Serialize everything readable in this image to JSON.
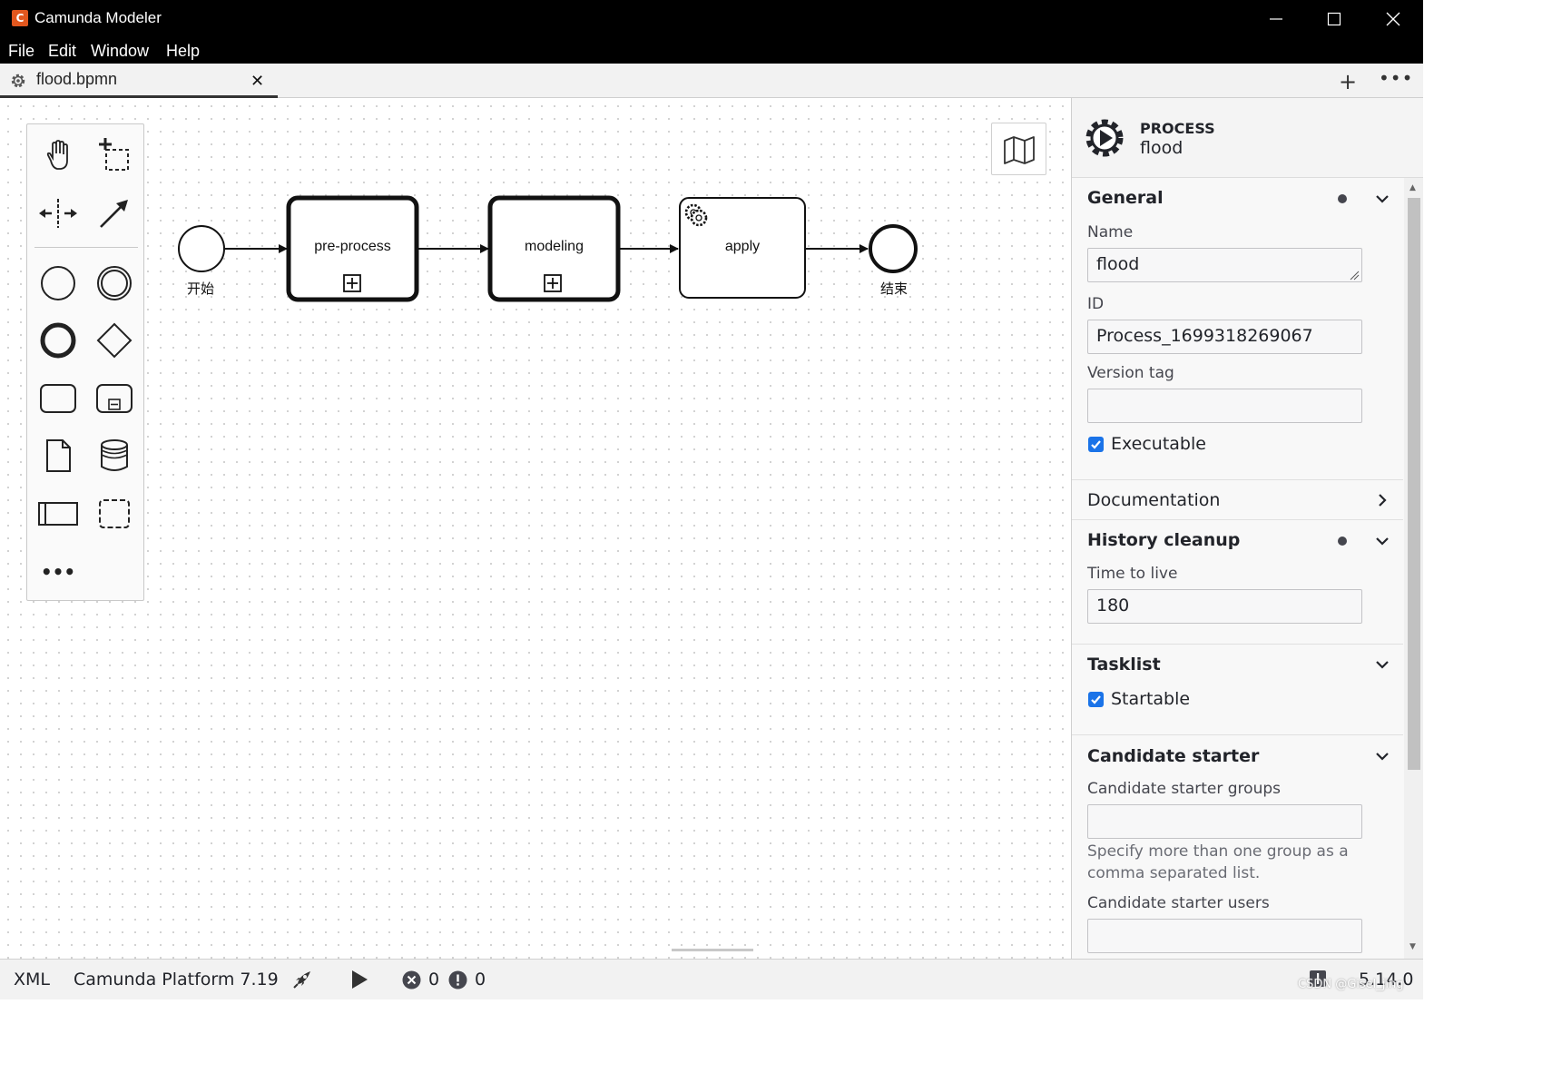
{
  "window": {
    "title": "Camunda Modeler",
    "logo_glyph": "C"
  },
  "menu": {
    "items": [
      "File",
      "Edit",
      "Window",
      "Help"
    ]
  },
  "tabs": {
    "active": {
      "label": "flood.bpmn",
      "close_glyph": "✕"
    },
    "add_glyph": "+",
    "more_glyph": "•••"
  },
  "palette": {
    "more_glyph": "•••",
    "tools": [
      "hand-tool",
      "lasso-tool",
      "space-tool",
      "global-connect-tool",
      "create-start-event",
      "create-intermediate-event",
      "create-end-event",
      "create-gateway",
      "create-task",
      "create-subprocess",
      "create-data-object",
      "create-data-store",
      "create-pool",
      "create-group"
    ]
  },
  "diagram": {
    "start_event_label": "开始",
    "end_event_label": "结束",
    "tasks": [
      {
        "name": "pre-process",
        "type": "collapsed-subprocess"
      },
      {
        "name": "modeling",
        "type": "collapsed-subprocess"
      },
      {
        "name": "apply",
        "type": "service-task"
      }
    ]
  },
  "properties": {
    "header": {
      "type": "PROCESS",
      "name": "flood"
    },
    "general": {
      "title": "General",
      "name_label": "Name",
      "name_value": "flood",
      "id_label": "ID",
      "id_value": "Process_1699318269067",
      "version_label": "Version tag",
      "version_value": "",
      "executable_label": "Executable",
      "executable_checked": true
    },
    "documentation": {
      "title": "Documentation"
    },
    "history": {
      "title": "History cleanup",
      "ttl_label": "Time to live",
      "ttl_value": "180"
    },
    "tasklist": {
      "title": "Tasklist",
      "startable_label": "Startable",
      "startable_checked": true
    },
    "candidate": {
      "title": "Candidate starter",
      "groups_label": "Candidate starter groups",
      "groups_value": "",
      "hint": "Specify more than one group as a comma separated list.",
      "users_label": "Candidate starter users",
      "users_value": ""
    }
  },
  "statusbar": {
    "xml": "XML",
    "platform": "Camunda Platform 7.19",
    "errors": "0",
    "warnings": "0",
    "version": "5.14.0",
    "watermark": "CSDN @Gisel_jing"
  },
  "colors": {
    "titlebar": "#000000",
    "logo": "#e2571e",
    "checkbox": "#1a73e8"
  }
}
